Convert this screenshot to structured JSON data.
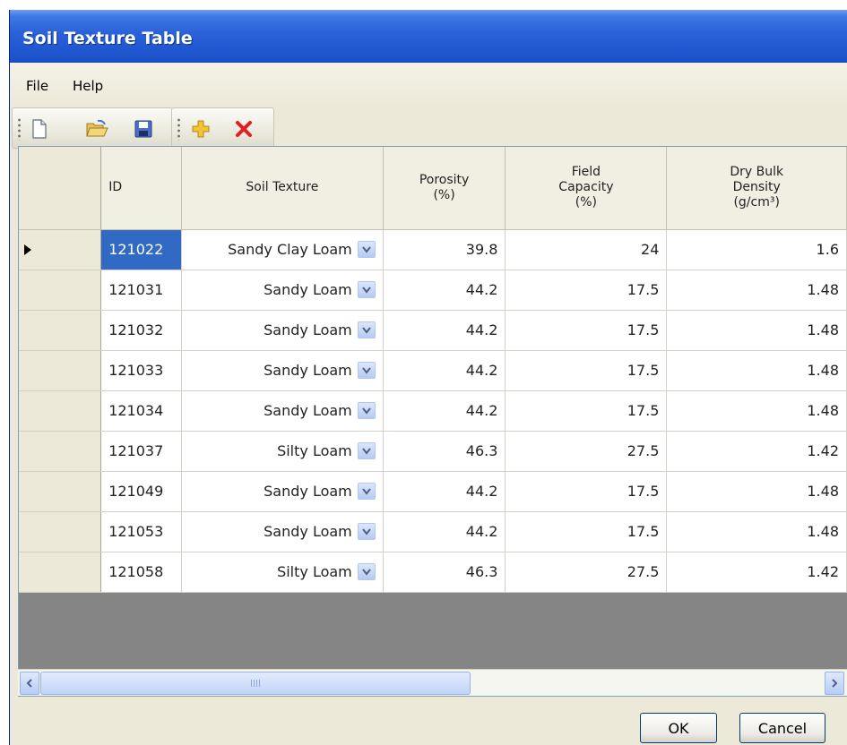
{
  "window": {
    "title": "Soil Texture Table"
  },
  "menu": {
    "items": [
      "File",
      "Help"
    ]
  },
  "toolbar": {
    "buttons": [
      "new-file-icon",
      "open-folder-icon",
      "save-icon",
      "add-row-icon",
      "delete-row-icon"
    ]
  },
  "table": {
    "headers": {
      "id": "ID",
      "texture": "Soil Texture",
      "porosity": [
        "Porosity",
        "(%)"
      ],
      "field_capacity": [
        "Field",
        "Capacity",
        "(%)"
      ],
      "bulk_density": [
        "Dry Bulk",
        "Density",
        "(g/cm³)"
      ]
    },
    "rows": [
      {
        "id": "121022",
        "texture": "Sandy Clay Loam",
        "porosity": "39.8",
        "field_capacity": "24",
        "bulk_density": "1.6",
        "current": true,
        "selected": true
      },
      {
        "id": "121031",
        "texture": "Sandy Loam",
        "porosity": "44.2",
        "field_capacity": "17.5",
        "bulk_density": "1.48"
      },
      {
        "id": "121032",
        "texture": "Sandy Loam",
        "porosity": "44.2",
        "field_capacity": "17.5",
        "bulk_density": "1.48"
      },
      {
        "id": "121033",
        "texture": "Sandy Loam",
        "porosity": "44.2",
        "field_capacity": "17.5",
        "bulk_density": "1.48"
      },
      {
        "id": "121034",
        "texture": "Sandy Loam",
        "porosity": "44.2",
        "field_capacity": "17.5",
        "bulk_density": "1.48"
      },
      {
        "id": "121037",
        "texture": "Silty Loam",
        "porosity": "46.3",
        "field_capacity": "27.5",
        "bulk_density": "1.42"
      },
      {
        "id": "121049",
        "texture": "Sandy Loam",
        "porosity": "44.2",
        "field_capacity": "17.5",
        "bulk_density": "1.48"
      },
      {
        "id": "121053",
        "texture": "Sandy Loam",
        "porosity": "44.2",
        "field_capacity": "17.5",
        "bulk_density": "1.48"
      },
      {
        "id": "121058",
        "texture": "Silty Loam",
        "porosity": "46.3",
        "field_capacity": "27.5",
        "bulk_density": "1.42"
      }
    ]
  },
  "buttons": {
    "ok": "OK",
    "cancel": "Cancel"
  },
  "colors": {
    "titlebar": "#2a60d8",
    "selection": "#316ac5",
    "grid_empty": "#858585",
    "window_bg": "#ece9d8"
  }
}
